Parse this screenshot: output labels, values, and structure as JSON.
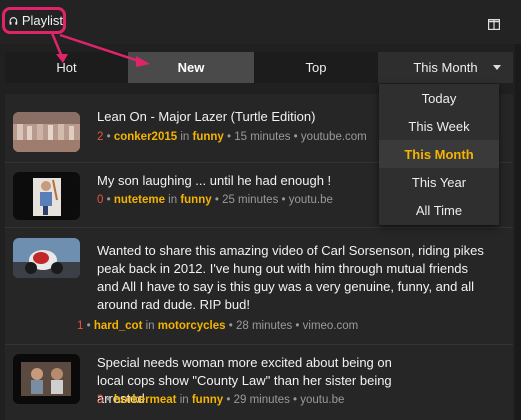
{
  "topbar": {
    "playlist_label": "Playlist"
  },
  "tabs": [
    {
      "label": "Hot"
    },
    {
      "label": "New"
    },
    {
      "label": "Top"
    },
    {
      "label": "This Month"
    }
  ],
  "dropdown": {
    "options": [
      "Today",
      "This Week",
      "This Month",
      "This Year",
      "All Time"
    ],
    "selected": "This Month"
  },
  "feed": {
    "items": [
      {
        "title": "Lean On - Major Lazer (Turtle Edition)",
        "score": "2",
        "user": "conker2015",
        "in": "in",
        "subreddit": "funny",
        "time": "• 15 minutes •",
        "domain": "youtube.com"
      },
      {
        "title": "My son laughing ... until he had enough !",
        "score": "0",
        "user": "nuteteme",
        "in": "in",
        "subreddit": "funny",
        "time": "• 25 minutes •",
        "domain": "youtu.be"
      },
      {
        "title": "Wanted to share this amazing video of Carl Sorsenson, riding pikes peak back in 2012. I've hung out with him through mutual friends and All I have to say is this guy was a very genuine, funny, and all around rad dude. RIP bud!",
        "score": "1",
        "user": "hard_cot",
        "in": "in",
        "subreddit": "motorcycles",
        "time": "• 28 minutes •",
        "domain": "vimeo.com"
      },
      {
        "title": "Special needs woman more excited about being on local cops show \"County Law\" than her sister being arrested",
        "score": "3",
        "user": "horkermeat",
        "in": "in",
        "subreddit": "funny",
        "time": "• 29 minutes •",
        "domain": "youtu.be"
      }
    ]
  },
  "colors": {
    "highlight": "#e0246a",
    "accent": "#f5b400",
    "score": "#e8553b"
  }
}
